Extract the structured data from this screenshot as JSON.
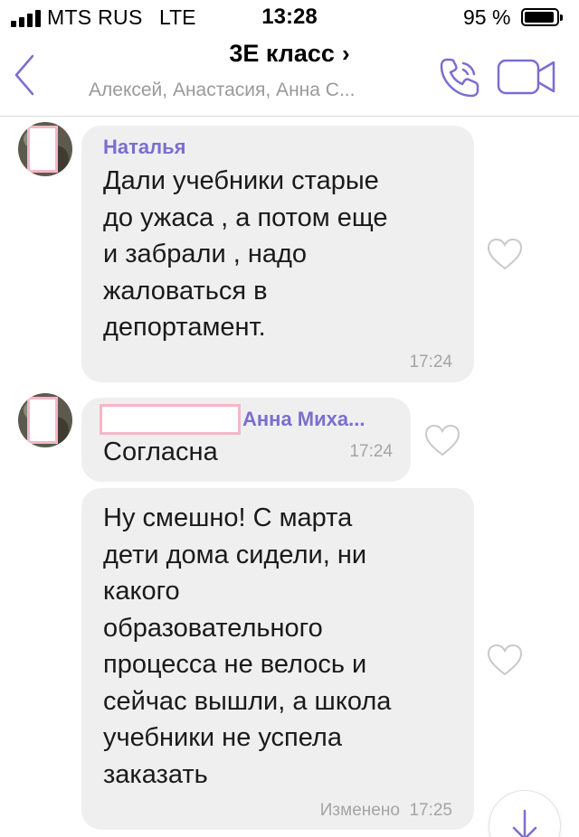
{
  "status_bar": {
    "carrier": "MTS RUS",
    "network": "LTE",
    "time": "13:28",
    "battery": "95 %",
    "battery_level": 0.95
  },
  "header": {
    "title": "3Е класс",
    "title_chevron": "›",
    "subtitle": "Алексей, Анастасия, Анна С...",
    "icons": {
      "back": "chevron-left-icon",
      "call": "phone-icon",
      "video": "video-camera-icon"
    },
    "accent_color": "#7b6ecf"
  },
  "messages": [
    {
      "sender": "Наталья",
      "text": "Дали учебники старые\nдо ужаса , а потом еще\nи забрали , надо\nжаловаться в\nдепортамент.",
      "time": "17:24",
      "liked": false
    },
    {
      "sender": "Анна Миха...",
      "text": "Согласна",
      "time": "17:24",
      "liked": false
    },
    {
      "sender": "",
      "text": "Ну смешно! С марта\nдети дома сидели, ни\nкакого\nобразовательного\nпроцесса не велось и\nсейчас вышли, а школа\nучебники не успела\nзаказать",
      "time": "17:25",
      "edited_label": "Изменено",
      "liked": false
    }
  ],
  "colors": {
    "bubble": "#efefef",
    "sender": "#7b6ecf",
    "timestamp": "#a4a4a4",
    "redaction": "#f4b6c8"
  }
}
